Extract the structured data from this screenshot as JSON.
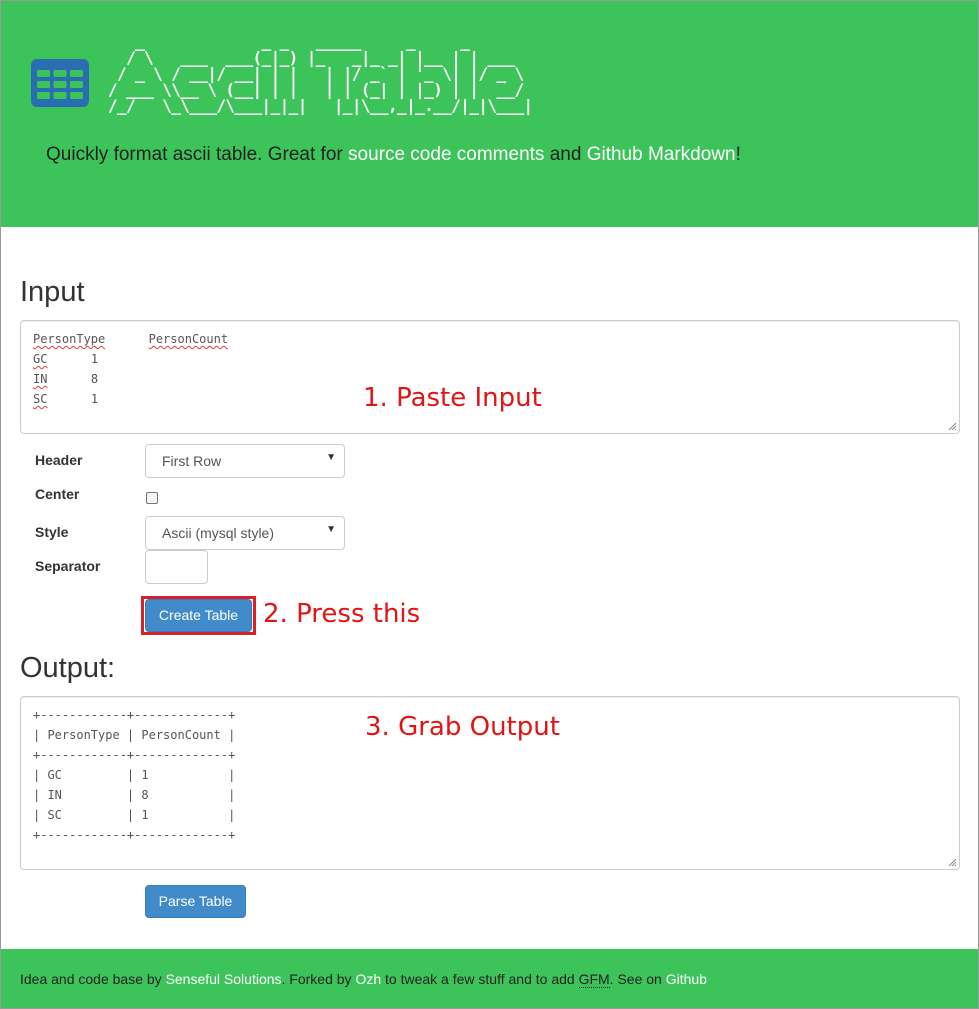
{
  "header": {
    "logo_text": "Ascii Table",
    "logo_ascii": "   _             _ _   _____     _     _\n  / \\   ___  ___(_|_) |_   _|_ _| |__ | | ___\n / _ \\ / __|/ __| | |   | |/ _` | '_ \\| |/ _ \\\n/ ___ \\\\__ \\ (__| | |   | | (_| | |_) | |  __/\n/_/   \\_\\___/\\___|_|_|   |_|\\__,_|_.__/|_|\\___|",
    "tagline_prefix": "Quickly format ascii table. Great for ",
    "tagline_link1": "source code comments",
    "tagline_mid": " and ",
    "tagline_link2": "Github Markdown",
    "tagline_suffix": "!"
  },
  "input_section": {
    "title": "Input",
    "rows": [
      [
        "PersonType",
        "PersonCount"
      ],
      [
        "GC",
        "1"
      ],
      [
        "IN",
        "8"
      ],
      [
        "SC",
        "1"
      ]
    ]
  },
  "options": {
    "header_label": "Header",
    "header_value": "First Row",
    "center_label": "Center",
    "center_checked": false,
    "style_label": "Style",
    "style_value": "Ascii (mysql style)",
    "separator_label": "Separator",
    "separator_value": ""
  },
  "buttons": {
    "create": "Create Table",
    "parse": "Parse Table"
  },
  "output_section": {
    "title": "Output:",
    "lines": [
      "+------------+-------------+",
      "| PersonType | PersonCount |",
      "+------------+-------------+",
      "| GC         | 1           |",
      "| IN         | 8           |",
      "| SC         | 1           |",
      "+------------+-------------+"
    ]
  },
  "annotations": {
    "step1": "1. Paste Input",
    "step2": "2. Press this",
    "step3": "3. Grab Output"
  },
  "footer": {
    "t1": "Idea and code base by ",
    "link1": "Senseful Solutions",
    "t2": ". Forked by ",
    "link2": "Ozh",
    "t3": " to tweak a few stuff and to add ",
    "abbr": "GFM",
    "t4": ". See on ",
    "link3": "Github"
  },
  "colors": {
    "brand_green": "#3cc45a",
    "button_blue": "#428bca",
    "annotation_red": "#e11515",
    "logo_icon_blue": "#2a6db0"
  }
}
